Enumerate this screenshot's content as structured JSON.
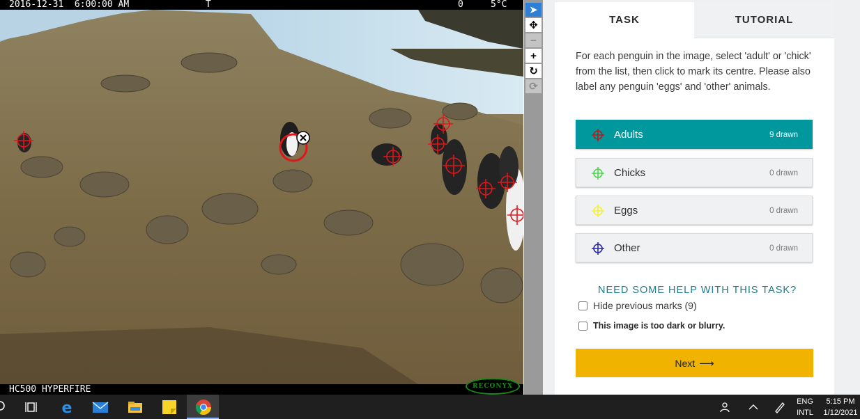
{
  "camera": {
    "timestamp": "2016-12-31  6:00:00 AM",
    "marker_t": "T",
    "moon": "0",
    "temperature": "5°C",
    "model": "HC500 HYPERFIRE",
    "brand": "RECONYX"
  },
  "toolbar": {
    "tools": [
      {
        "name": "pointer",
        "glyph": "➤",
        "state": "active"
      },
      {
        "name": "pan",
        "glyph": "✥",
        "state": "normal"
      },
      {
        "name": "zoom-out",
        "glyph": "−",
        "state": "disabled"
      },
      {
        "name": "zoom-in",
        "glyph": "+",
        "state": "normal"
      },
      {
        "name": "rotate",
        "glyph": "↻",
        "state": "normal"
      },
      {
        "name": "reset",
        "glyph": "⟳",
        "state": "disabled"
      }
    ]
  },
  "tabs": {
    "task": "TASK",
    "tutorial": "TUTORIAL"
  },
  "task": {
    "instructions": "For each penguin in the image, select 'adult' or 'chick' from the list, then click to mark its centre. Please also label any penguin 'eggs' and 'other' animals.",
    "options": [
      {
        "label": "Adults",
        "count": "9 drawn",
        "color": "#b71c1c",
        "selected": true
      },
      {
        "label": "Chicks",
        "count": "0 drawn",
        "color": "#4cd94c",
        "selected": false
      },
      {
        "label": "Eggs",
        "count": "0 drawn",
        "color": "#f3f33a",
        "selected": false
      },
      {
        "label": "Other",
        "count": "0 drawn",
        "color": "#2a2aa8",
        "selected": false
      }
    ],
    "help": "NEED SOME HELP WITH THIS TASK?",
    "hide_marks": "Hide previous marks (9)",
    "too_dark": "This image is too dark or blurry.",
    "next": "Next",
    "next_arrow": "⟶"
  },
  "colors": {
    "accent": "#00979d",
    "next_button": "#f0b400",
    "marker": "#e0161b",
    "active_tool": "#2f7fd4"
  },
  "taskbar": {
    "icons": [
      "search-icon",
      "task-view-icon",
      "edge-icon",
      "mail-icon",
      "file-explorer-icon",
      "sticky-notes-icon",
      "chrome-icon"
    ],
    "tray": {
      "lang_top": "ENG",
      "lang_bottom": "INTL",
      "time": "5:15 PM",
      "date": "1/12/2021"
    }
  }
}
